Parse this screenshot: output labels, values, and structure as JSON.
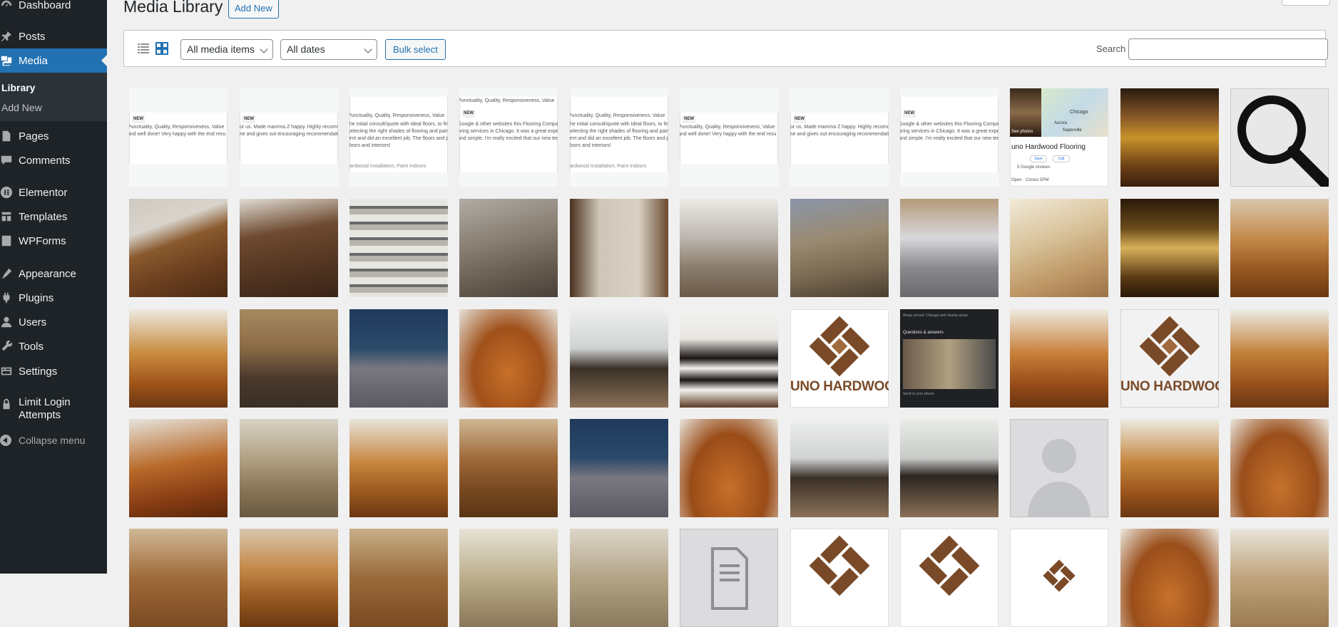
{
  "sidebar": {
    "items": [
      {
        "label": "Dashboard",
        "icon": "dashboard-icon"
      },
      {
        "label": "Posts",
        "icon": "pin-icon"
      },
      {
        "label": "Media",
        "icon": "media-icon"
      },
      {
        "label": "Pages",
        "icon": "pages-icon"
      },
      {
        "label": "Comments",
        "icon": "comments-icon"
      },
      {
        "label": "Elementor",
        "icon": "elementor-icon"
      },
      {
        "label": "Templates",
        "icon": "templates-icon"
      },
      {
        "label": "WPForms",
        "icon": "wpforms-icon"
      },
      {
        "label": "Appearance",
        "icon": "appearance-icon"
      },
      {
        "label": "Plugins",
        "icon": "plugins-icon"
      },
      {
        "label": "Users",
        "icon": "users-icon"
      },
      {
        "label": "Tools",
        "icon": "tools-icon"
      },
      {
        "label": "Settings",
        "icon": "settings-icon"
      }
    ],
    "submenu": {
      "library": "Library",
      "add_new": "Add New"
    },
    "limit_login": {
      "line1": "Limit Login",
      "line2": "Attempts"
    },
    "collapse": "Collapse menu",
    "accent": "#2271b1"
  },
  "header": {
    "title": "Media Library",
    "add_new": "Add New"
  },
  "toolbar": {
    "filter_type": "All media items",
    "filter_date": "All dates",
    "bulk_select": "Bulk select",
    "search_label": "Search",
    "search_value": ""
  },
  "grid": {
    "review_new": "NEW",
    "review_a_line1": "Punctuality, Quality, Responsiveness, Value",
    "review_a_line2": "and well done! Very happy with the end resu",
    "review_b_line1": "for us. Made mamma Z happy. Highly recomme",
    "review_b_line2": "me and gives out encouraging recommendatio",
    "review_c_line0": "Punctuality, Quality, Responsiveness, Value",
    "review_c_line1": "the initial consult/quote with Ideal floors, to final",
    "review_c_line2": "selecting the right shades of flooring and paint c",
    "review_c_line3": "lent and did an excellent job.  The floors and pain",
    "review_c_line4": "floors and interiors!",
    "review_c_tag": "ardwood Installation, Paint Indoors",
    "review_d_line0": "Punctuality, Quality, Responsiveness, Value",
    "review_d_line1": "Google & other websites this Flooring Company ha",
    "review_d_line2": "oring services in Chicago. It was a great experienc",
    "review_d_line3": "and simple. I'm really excited that our new tenants",
    "logo_text": "UNO HARDWOOD FLO",
    "map_title": "uno Hardwood Flooring",
    "map_reviews": "5 Google reviews",
    "map_open": "Open · Closes 5PM",
    "map_city": "Chicago",
    "map_city2": "Aurora",
    "map_city3": "Naperville",
    "map_btn1": "Save",
    "map_btn2": "Call",
    "map_photos": "See photos",
    "dark_title": "Questions & answers",
    "dark_sub": "Areas served: Chicago and nearby areas",
    "dark_foot": "Send to your phone"
  }
}
